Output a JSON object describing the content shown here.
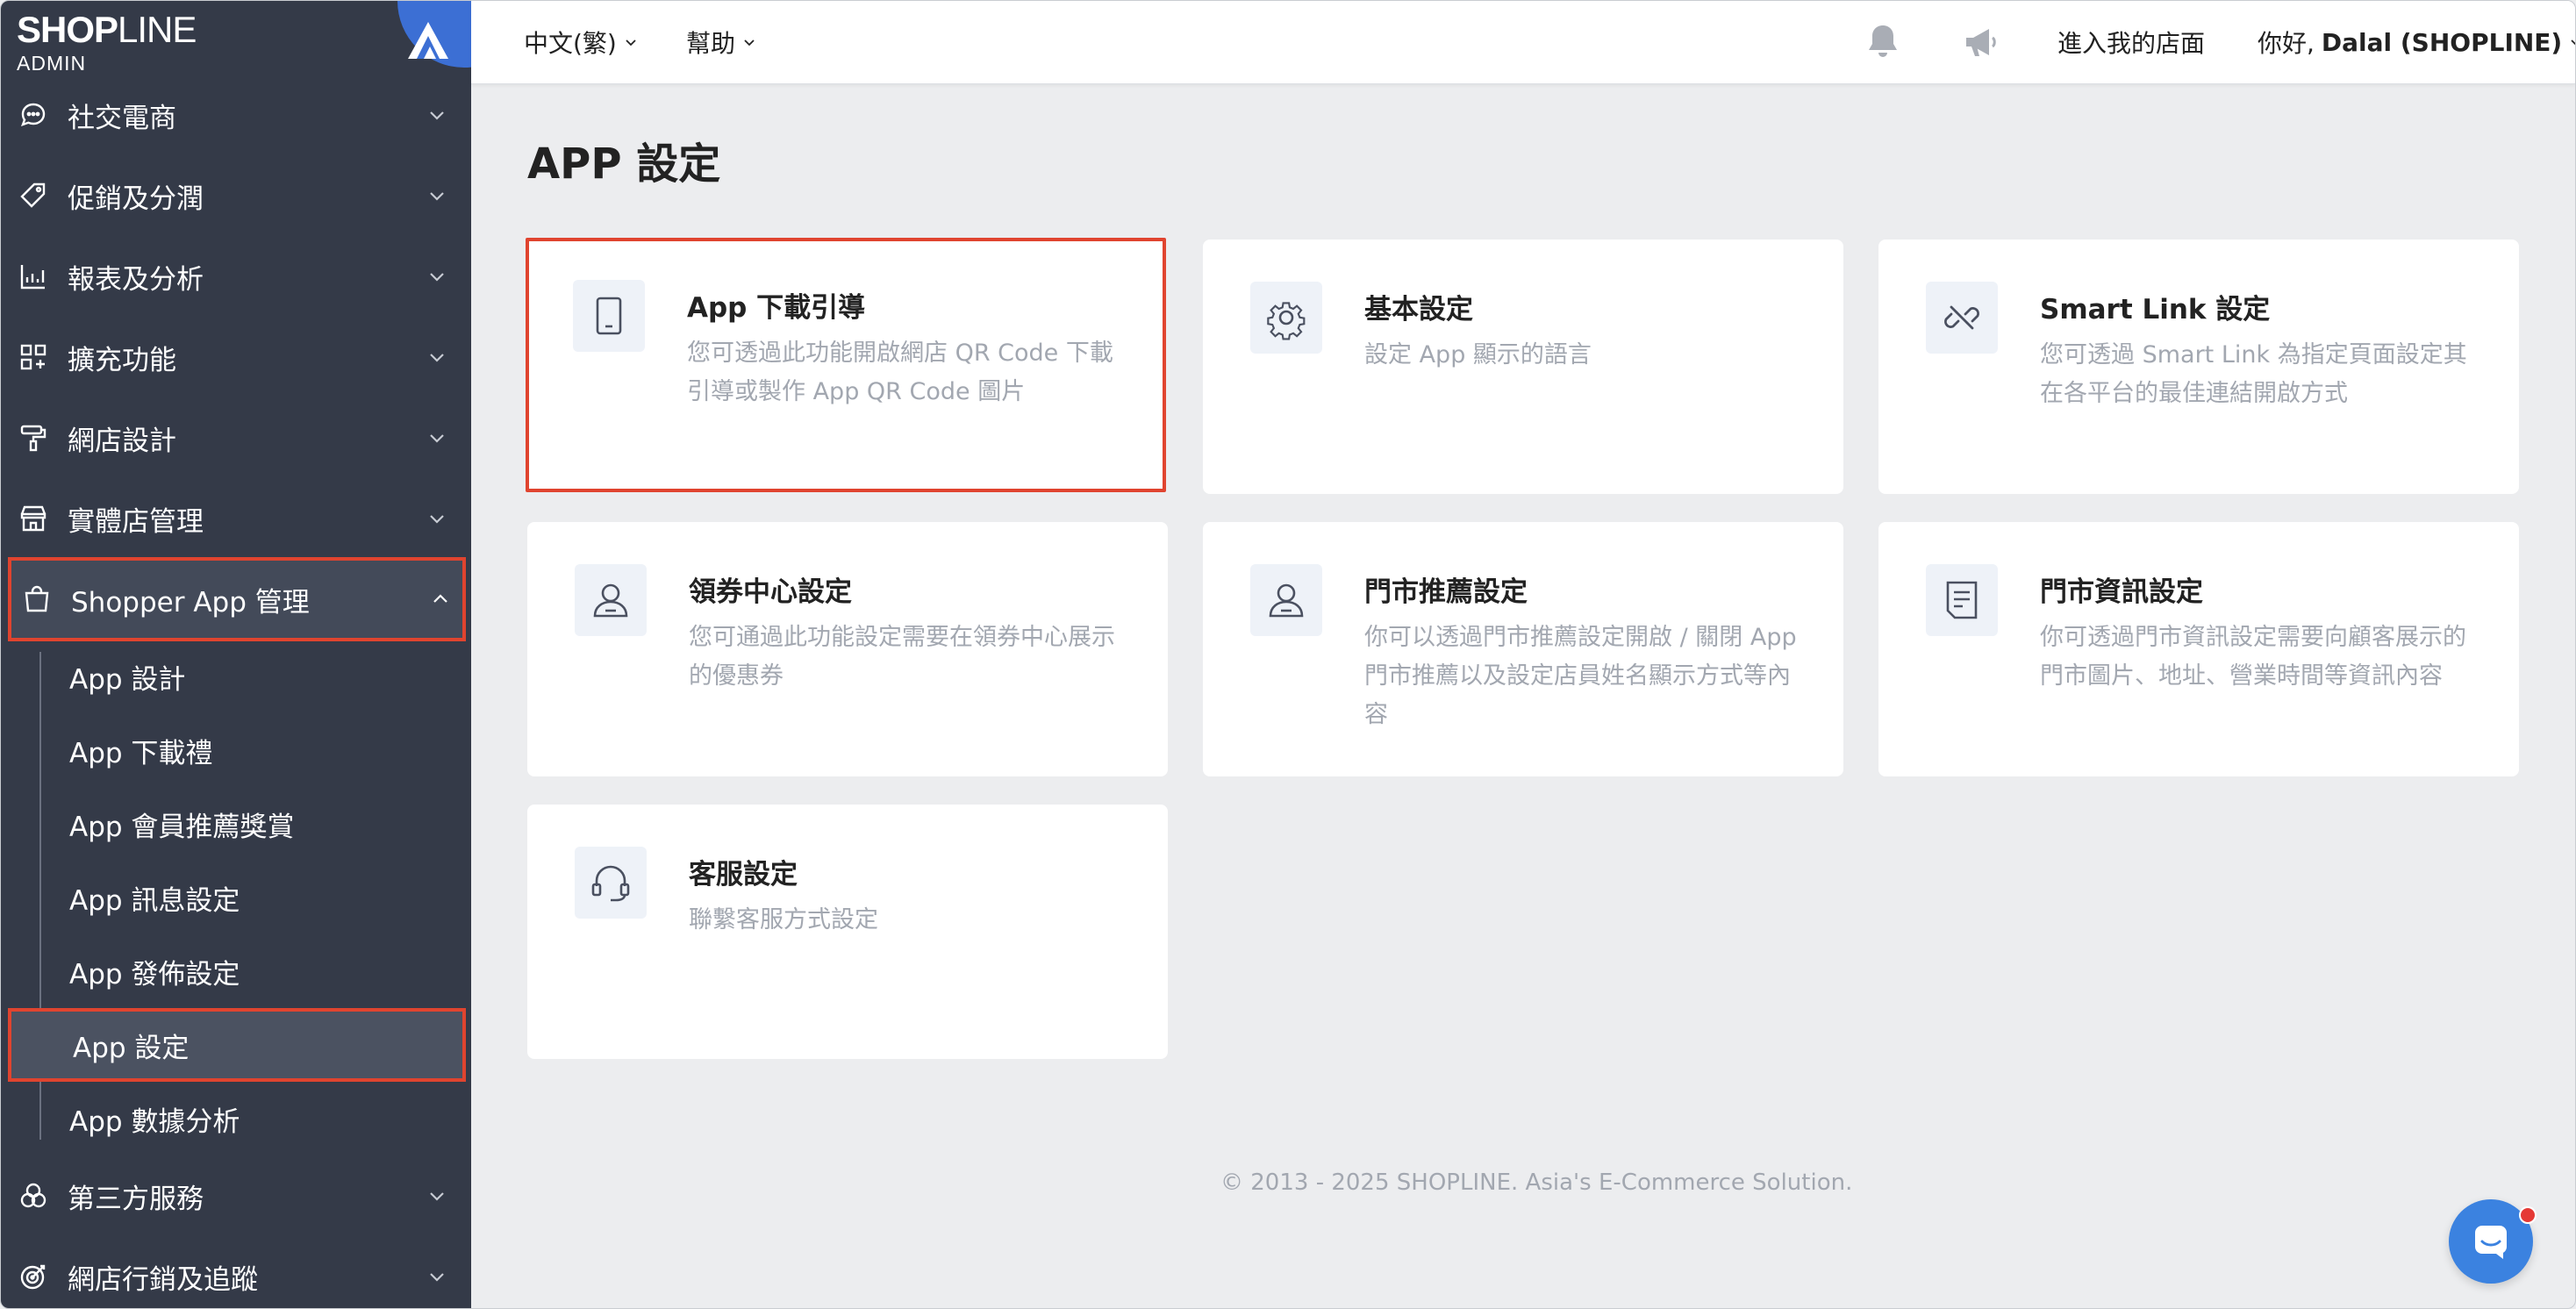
{
  "brand": {
    "logo_main": "SHOP",
    "logo_thin": "LINE",
    "logo_sub": "ADMIN"
  },
  "sidebar": {
    "items": [
      {
        "label": "社交電商",
        "icon": "chat-bubble-icon"
      },
      {
        "label": "促銷及分潤",
        "icon": "tag-icon"
      },
      {
        "label": "報表及分析",
        "icon": "chart-icon"
      },
      {
        "label": "擴充功能",
        "icon": "apps-grid-icon"
      },
      {
        "label": "網店設計",
        "icon": "paint-roller-icon"
      },
      {
        "label": "實體店管理",
        "icon": "store-icon"
      },
      {
        "label": "Shopper App 管理",
        "icon": "shopping-bag-icon",
        "expanded": true
      },
      {
        "label": "第三方服務",
        "icon": "circles-icon"
      },
      {
        "label": "網店行銷及追蹤",
        "icon": "target-icon"
      }
    ],
    "sub_items": [
      {
        "label": "App 設計"
      },
      {
        "label": "App 下載禮"
      },
      {
        "label": "App 會員推薦獎賞"
      },
      {
        "label": "App 訊息設定"
      },
      {
        "label": "App 發佈設定"
      },
      {
        "label": "App 設定",
        "active": true
      },
      {
        "label": "App 數據分析"
      }
    ]
  },
  "topbar": {
    "language": "中文(繁)",
    "help": "幫助",
    "visit_store": "進入我的店面",
    "greeting": "你好,",
    "user_name": "Dalal (SHOPLINE)"
  },
  "page": {
    "title": "APP 設定",
    "cards": [
      {
        "title": "App 下載引導",
        "desc": "您可透過此功能開啟網店 QR Code 下載引導或製作 App QR Code 圖片",
        "icon": "tablet-icon",
        "selected": true
      },
      {
        "title": "基本設定",
        "desc": "設定 App 顯示的語言",
        "icon": "gear-icon"
      },
      {
        "title": "Smart Link 設定",
        "desc": "您可透過 Smart Link 為指定頁面設定其在各平台的最佳連結開啟方式",
        "icon": "link-icon"
      },
      {
        "title": "領券中心設定",
        "desc": "您可通過此功能設定需要在領券中心展示的優惠券",
        "icon": "user-icon"
      },
      {
        "title": "門市推薦設定",
        "desc": "你可以透過門市推薦設定開啟 / 關閉 App 門市推薦以及設定店員姓名顯示方式等內容",
        "icon": "user-icon"
      },
      {
        "title": "門市資訊設定",
        "desc": "你可透過門市資訊設定需要向顧客展示的門市圖片、地址、營業時間等資訊內容",
        "icon": "document-icon"
      },
      {
        "title": "客服設定",
        "desc": "聯繫客服方式設定",
        "icon": "headset-icon"
      }
    ]
  },
  "footer": {
    "text": "© 2013 - 2025  SHOPLINE. Asia's E-Commerce Solution."
  },
  "colors": {
    "sidebar_bg": "#343a48",
    "highlight": "#e0442f",
    "brand_blue": "#3c6fd4"
  }
}
